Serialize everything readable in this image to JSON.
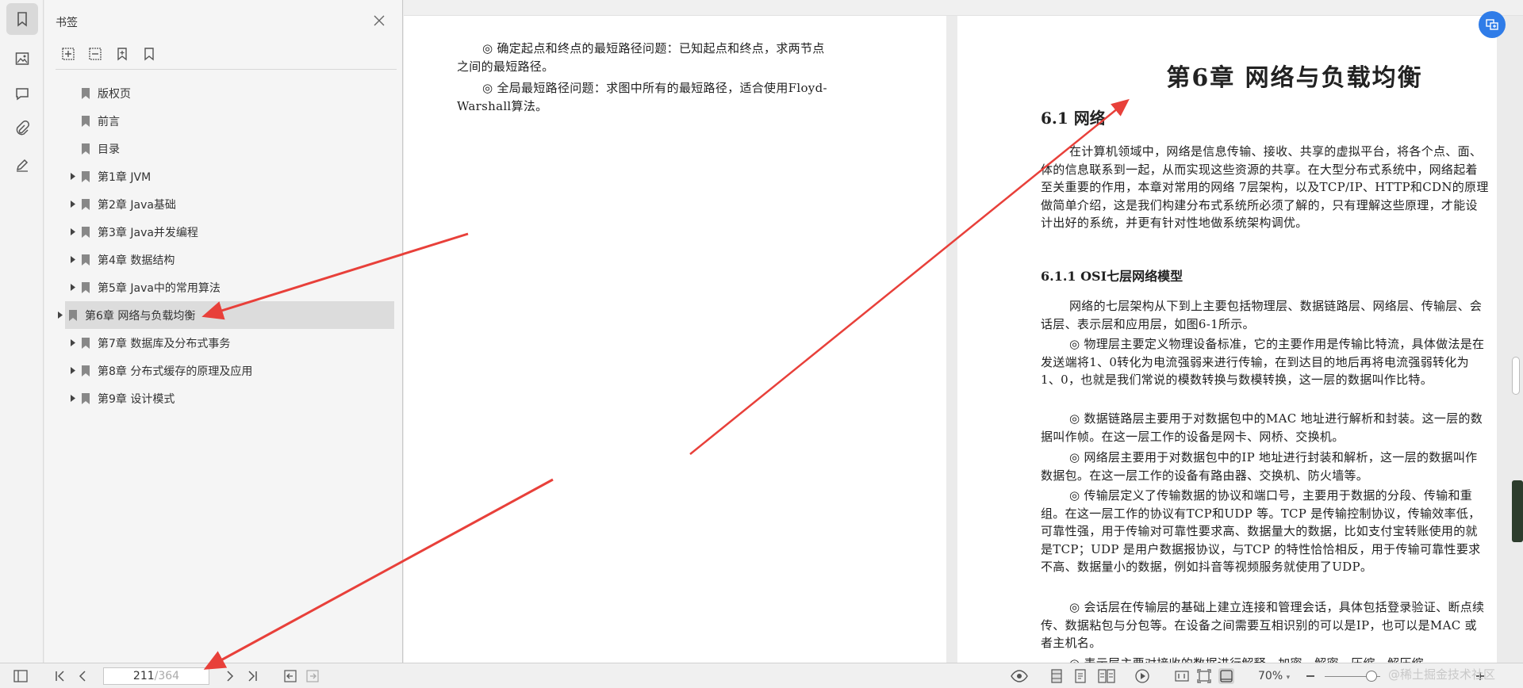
{
  "panel": {
    "title": "书签",
    "items": [
      {
        "label": "版权页",
        "expandable": false
      },
      {
        "label": "前言",
        "expandable": false
      },
      {
        "label": "目录",
        "expandable": false
      },
      {
        "label": "第1章 JVM",
        "expandable": true
      },
      {
        "label": "第2章 Java基础",
        "expandable": true
      },
      {
        "label": "第3章 Java并发编程",
        "expandable": true
      },
      {
        "label": "第4章 数据结构",
        "expandable": true
      },
      {
        "label": "第5章 Java中的常用算法",
        "expandable": true
      },
      {
        "label": "第6章 网络与负载均衡",
        "expandable": true,
        "selected": true
      },
      {
        "label": "第7章 数据库及分布式事务",
        "expandable": true
      },
      {
        "label": "第8章 分布式缓存的原理及应用",
        "expandable": true
      },
      {
        "label": "第9章 设计模式",
        "expandable": true
      }
    ]
  },
  "left_page": {
    "p1": "◎ 确定起点和终点的最短路径问题：已知起点和终点，求两节点之间的最短路径。",
    "p2": "◎ 全局最短路径问题：求图中所有的最短路径，适合使用Floyd-Warshall算法。"
  },
  "right_page": {
    "chapter_title": "第6章 网络与负载均衡",
    "section_title": "6.1 网络",
    "intro": "在计算机领域中，网络是信息传输、接收、共享的虚拟平台，将各个点、面、体的信息联系到一起，从而实现这些资源的共享。在大型分布式系统中，网络起着至关重要的作用，本章对常用的网络 7层架构，以及TCP/IP、HTTP和CDN的原理做简单介绍，这是我们构建分布式系统所必须了解的，只有理解这些原理，才能设计出好的系统，并更有针对性地做系统架构调优。",
    "subsection_title": "6.1.1 OSI七层网络模型",
    "p_layers": "网络的七层架构从下到上主要包括物理层、数据链路层、网络层、传输层、会话层、表示层和应用层，如图6-1所示。",
    "p_physical": "◎ 物理层主要定义物理设备标准，它的主要作用是传输比特流，具体做法是在发送端将1、0转化为电流强弱来进行传输，在到达目的地后再将电流强弱转化为 1、0，也就是我们常说的模数转换与数模转换，这一层的数据叫作比特。",
    "p_datalink": "◎ 数据链路层主要用于对数据包中的MAC 地址进行解析和封装。这一层的数据叫作帧。在这一层工作的设备是网卡、网桥、交换机。",
    "p_network": "◎ 网络层主要用于对数据包中的IP 地址进行封装和解析，这一层的数据叫作数据包。在这一层工作的设备有路由器、交换机、防火墙等。",
    "p_transport": "◎ 传输层定义了传输数据的协议和端口号，主要用于数据的分段、传输和重组。在这一层工作的协议有TCP和UDP 等。TCP 是传输控制协议，传输效率低，可靠性强，用于传输对可靠性要求高、数据量大的数据，比如支付宝转账使用的就是TCP；UDP 是用户数据报协议，与TCP 的特性恰恰相反，用于传输可靠性要求不高、数据量小的数据，例如抖音等视频服务就使用了UDP。",
    "p_session": "◎ 会话层在传输层的基础上建立连接和管理会话，具体包括登录验证、断点续传、数据粘包与分包等。在设备之间需要互相识别的可以是IP，也可以是MAC 或者主机名。",
    "p_presentation_partial": "◎ 表示层主要对接收的数据进行解释、加密、解密、压缩、解压缩"
  },
  "statusbar": {
    "current_page": "211",
    "total_pages": "/364",
    "zoom": "70%",
    "watermark": "@稀土掘金技术社区"
  },
  "colors": {
    "accent_blue": "#2f7ce8",
    "annotation_red": "#e8403a"
  }
}
